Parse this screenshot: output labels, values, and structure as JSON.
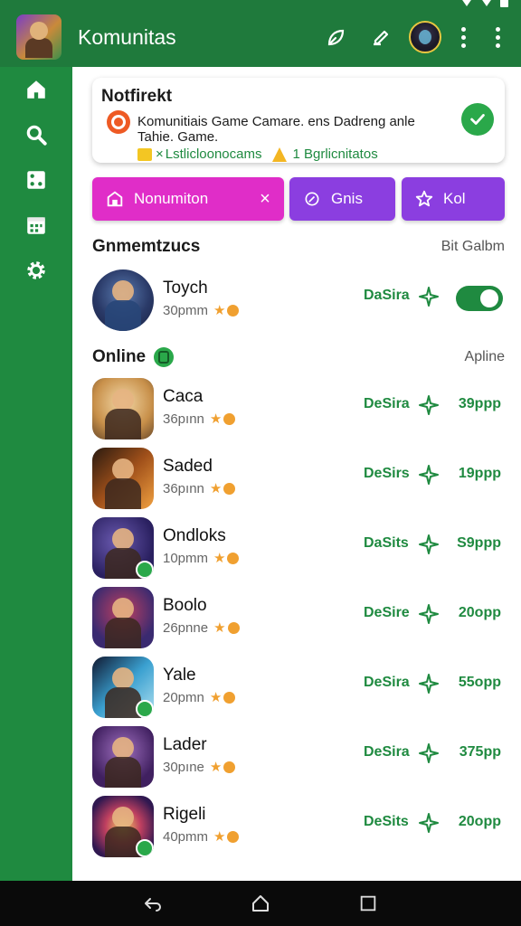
{
  "header": {
    "title": "Komunitas"
  },
  "notification": {
    "title": "Notfirekt",
    "message": "Komunitiais Game Camare. ens Dadreng anle Tahie. Game.",
    "meta_a": "Lstlicloonocams",
    "meta_b": "1 Bgrlicnitatos",
    "colors": {
      "icon": "#ee5a24",
      "check": "#2aa84a"
    }
  },
  "chips": [
    {
      "label": "Nonumiton",
      "color": "#e02dc8",
      "icon": "store-icon",
      "closable": true
    },
    {
      "label": "Gnis",
      "color": "#8b3ee0",
      "icon": "leaf-icon"
    },
    {
      "label": "Kol",
      "color": "#8b3ee0",
      "icon": "star-icon"
    }
  ],
  "sections": {
    "featured": {
      "title": "Gnmemtzucs",
      "right": "Bit Galbm"
    },
    "online": {
      "title": "Online",
      "right": "Apline"
    }
  },
  "featured_row": {
    "name": "Toych",
    "sub": "30pmm",
    "status": "DaSira",
    "toggle_on": true
  },
  "rows": [
    {
      "name": "Caca",
      "sub": "36pınn",
      "status": "DeSira",
      "value": "39ppp"
    },
    {
      "name": "Saded",
      "sub": "36pınn",
      "status": "DeSirs",
      "value": "19ppp"
    },
    {
      "name": "Ondloks",
      "sub": "10pmm",
      "status": "DaSits",
      "value": "S9ppp"
    },
    {
      "name": "Boolo",
      "sub": "26pnne",
      "status": "DeSire",
      "value": "20opp"
    },
    {
      "name": "Yale",
      "sub": "20pmn",
      "status": "DeSira",
      "value": "55opp"
    },
    {
      "name": "Lader",
      "sub": "30pıne",
      "status": "DeSira",
      "value": "375pp"
    },
    {
      "name": "Rigeli",
      "sub": "40pmm",
      "status": "DeSits",
      "value": "20opp"
    }
  ],
  "theme": {
    "primary": "#1f7a3c",
    "sidebar": "#1f8a40",
    "accent": "#1f8a40"
  }
}
